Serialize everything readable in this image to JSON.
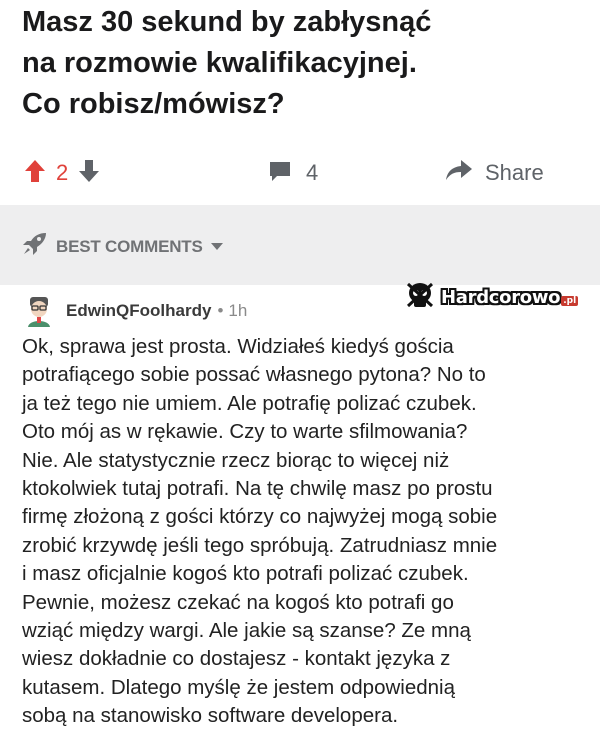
{
  "post": {
    "title_lines": [
      "Masz 30 sekund by zabłysnąć",
      "na rozmowie kwalifikacyjnej.",
      "Co robisz/mówisz?"
    ],
    "upvotes": "2",
    "comment_count": "4",
    "share_label": "Share"
  },
  "sort": {
    "label": "BEST COMMENTS"
  },
  "watermark": {
    "text": "Hardcorowo",
    "suffix": ".pl"
  },
  "comment": {
    "author": "EdwinQFoolhardy",
    "separator": "•",
    "time": "1h",
    "lines": [
      "Ok, sprawa jest prosta. Widziałeś kiedyś gościa",
      "potrafiącego sobie possać własnego pytona? No to",
      "ja też tego nie umiem. Ale potrafię polizać czubek.",
      "Oto mój as w rękawie. Czy to warte sfilmowania?",
      "Nie. Ale statystycznie rzecz biorąc to więcej niż",
      "ktokolwiek tutaj potrafi. Na tę chwilę masz po prostu",
      "firmę złożoną z gości którzy co najwyżej mogą sobie",
      "zrobić krzywdę jeśli tego spróbują. Zatrudniasz mnie",
      "i masz oficjalnie kogoś kto potrafi polizać czubek.",
      "Pewnie, możesz czekać na kogoś kto potrafi go",
      "wziąć między wargi. Ale jakie są szanse? Ze mną",
      "wiesz dokładnie co dostajesz - kontakt języka z",
      "kutasem. Dlatego myślę że jestem odpowiednią",
      "sobą na stanowisko software developera."
    ]
  },
  "colors": {
    "upvote": "#e0413a",
    "muted": "#5f6368",
    "sort_bg": "#eeeeef"
  },
  "icons": [
    "upvote-arrow-icon",
    "downvote-arrow-icon",
    "comment-bubble-icon",
    "share-arrow-icon",
    "rocket-icon",
    "chevron-down-icon",
    "skull-icon",
    "avatar-icon"
  ]
}
